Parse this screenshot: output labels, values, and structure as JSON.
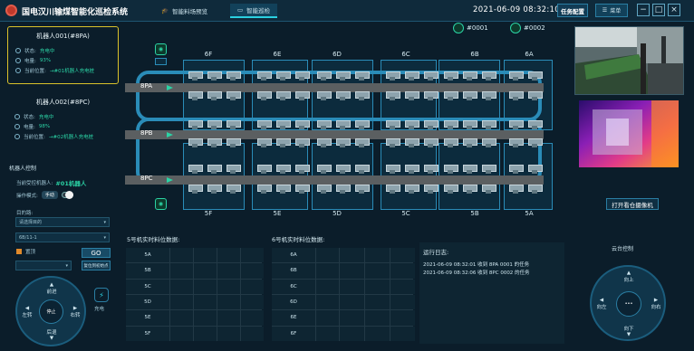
{
  "header": {
    "title": "国电汉川输煤智能化巡检系统",
    "tabs": [
      {
        "label": "智能料场预览",
        "icon": "graduation-cap-icon"
      },
      {
        "label": "智能巡检",
        "icon": "monitor-icon"
      }
    ],
    "datetime": "2021-06-09 08:32:10",
    "task_button": "任务配置",
    "menu_button": "菜单",
    "win": {
      "min": "−",
      "max": "□",
      "close": "×"
    }
  },
  "robots": [
    {
      "title": "机器人001(#8PA)",
      "rows": [
        {
          "label": "状态:",
          "value": "充电中"
        },
        {
          "label": "电量:",
          "value": "93%"
        },
        {
          "label": "当前位置:",
          "value": "→#01机器人充电桩"
        }
      ]
    },
    {
      "title": "机器人002(#8PC)",
      "rows": [
        {
          "label": "状态:",
          "value": "充电中"
        },
        {
          "label": "电量:",
          "value": "98%"
        },
        {
          "label": "当前位置:",
          "value": "→#02机器人充电桩"
        }
      ]
    }
  ],
  "control": {
    "title": "机器人控制",
    "current_robot_label": "当前受控机器人:",
    "current_robot": "#01机器人",
    "mode_label": "操作模式:",
    "mode": "手动",
    "path_label": "目的路:",
    "select1": "请选择目的",
    "select2": "6B/11-1",
    "checkbox_label": "置顶",
    "select3": "",
    "go": "GO",
    "reset": "复位到初始点",
    "dpad": {
      "up": "前进",
      "down": "后退",
      "left": "左转",
      "right": "右转",
      "center": "停止"
    },
    "charge": "充电"
  },
  "map": {
    "top_cols": [
      "6F",
      "6E",
      "6D",
      "6C",
      "6B",
      "6A"
    ],
    "bottom_cols": [
      "5F",
      "5E",
      "5D",
      "5C",
      "5B",
      "5A"
    ],
    "lanes": [
      "8PA",
      "8PB",
      "8PC"
    ],
    "robots": [
      {
        "id": "#0001"
      },
      {
        "id": "#0002"
      }
    ]
  },
  "tables": [
    {
      "title": "5号机实时料位数据:",
      "rows": [
        "5A",
        "5B",
        "5C",
        "5D",
        "5E",
        "5F"
      ]
    },
    {
      "title": "6号机实时料位数据:",
      "rows": [
        "6A",
        "6B",
        "6C",
        "6D",
        "6E",
        "6F"
      ]
    }
  ],
  "log": {
    "title": "运行日志:",
    "lines": [
      "2021-06-09 08:32:01  收到 8PA  0001 的任务",
      "2021-06-09 08:32:06  收到 8PC  0002 的任务"
    ]
  },
  "camera": {
    "button": "打开看仓摄像机"
  },
  "ptz": {
    "title": "云台控制",
    "up": "向上",
    "down": "向下",
    "left": "向左",
    "right": "向右"
  }
}
